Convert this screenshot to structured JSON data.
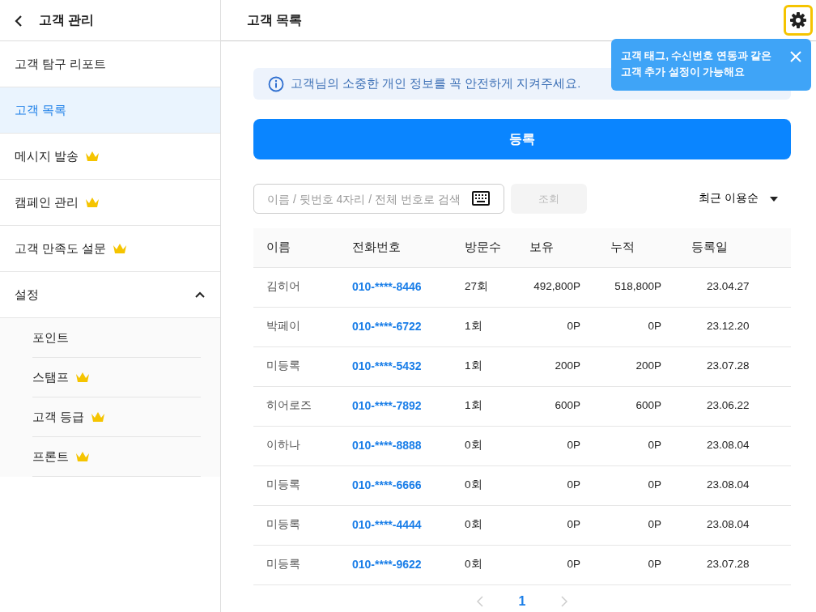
{
  "sidebar": {
    "title": "고객 관리",
    "items": [
      {
        "label": "고객 탐구 리포트",
        "premium": false,
        "selected": false,
        "kind": "item"
      },
      {
        "label": "고객 목록",
        "premium": false,
        "selected": true,
        "kind": "item"
      },
      {
        "label": "메시지 발송",
        "premium": true,
        "selected": false,
        "kind": "item"
      },
      {
        "label": "캠페인 관리",
        "premium": true,
        "selected": false,
        "kind": "item"
      },
      {
        "label": "고객 만족도 설문",
        "premium": true,
        "selected": false,
        "kind": "item"
      },
      {
        "label": "설정",
        "kind": "group",
        "expanded": true,
        "selected": false,
        "children": [
          {
            "label": "포인트",
            "premium": false
          },
          {
            "label": "스탬프",
            "premium": true
          },
          {
            "label": "고객 등급",
            "premium": true
          },
          {
            "label": "프론트",
            "premium": true
          }
        ]
      }
    ]
  },
  "header": {
    "title": "고객 목록"
  },
  "tooltip": {
    "text": "고객 태그, 수신번호 연동과 같은\n고객 추가 설정이 가능해요"
  },
  "notice": {
    "text": "고객님의 소중한 개인 정보를 꼭 안전하게 지켜주세요."
  },
  "register_button": "등록",
  "search": {
    "placeholder": "이름 / 뒷번호 4자리 / 전체 번호로 검색",
    "button": "조회",
    "button_disabled": true
  },
  "sort": {
    "label": "최근 이용순"
  },
  "table": {
    "columns": [
      "이름",
      "전화번호",
      "방문수",
      "보유",
      "누적",
      "등록일"
    ],
    "rows": [
      [
        "김히어",
        "010-****-8446",
        "27회",
        "492,800P",
        "518,800P",
        "23.04.27"
      ],
      [
        "박페이",
        "010-****-6722",
        "1회",
        "0P",
        "0P",
        "23.12.20"
      ],
      [
        "미등록",
        "010-****-5432",
        "1회",
        "200P",
        "200P",
        "23.07.28"
      ],
      [
        "히어로즈",
        "010-****-7892",
        "1회",
        "600P",
        "600P",
        "23.06.22"
      ],
      [
        "이하나",
        "010-****-8888",
        "0회",
        "0P",
        "0P",
        "23.08.04"
      ],
      [
        "미등록",
        "010-****-6666",
        "0회",
        "0P",
        "0P",
        "23.08.04"
      ],
      [
        "미등록",
        "010-****-4444",
        "0회",
        "0P",
        "0P",
        "23.08.04"
      ],
      [
        "미등록",
        "010-****-9622",
        "0회",
        "0P",
        "0P",
        "23.07.28"
      ]
    ]
  },
  "pagination": {
    "pages": [
      {
        "label": "1",
        "selected": true
      }
    ],
    "prev_disabled": true,
    "next_disabled": true
  }
}
